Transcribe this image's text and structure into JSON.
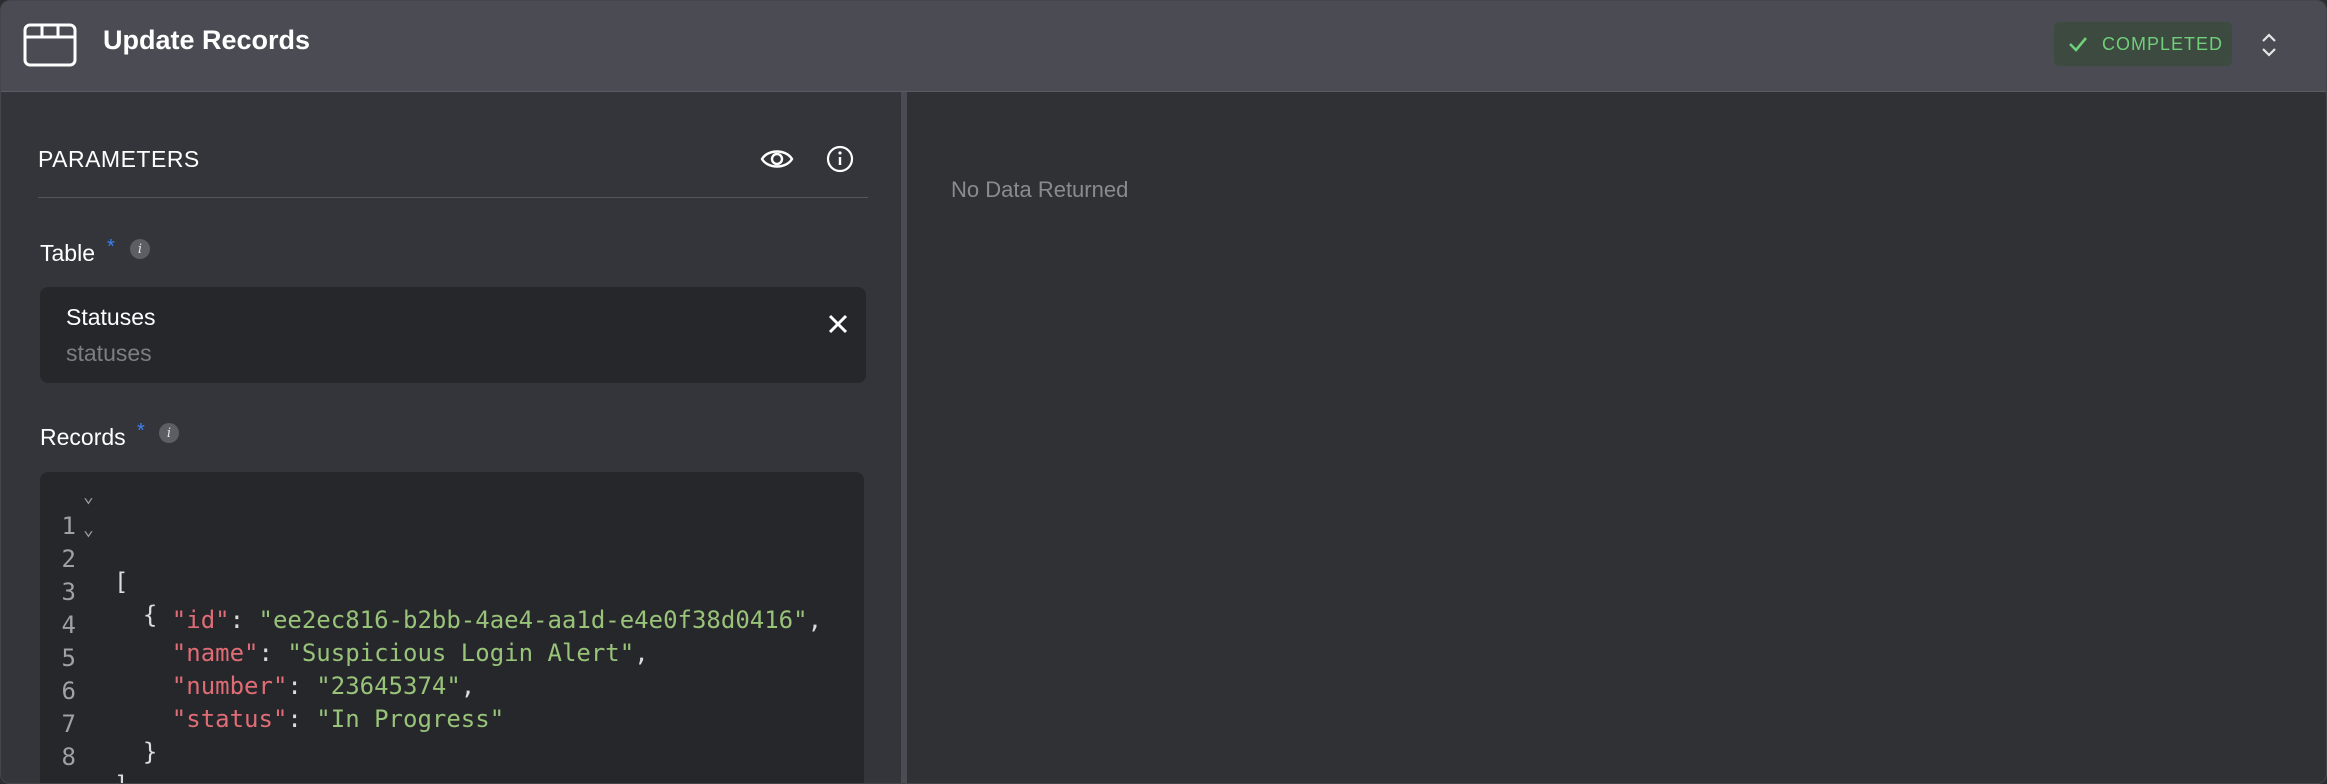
{
  "header": {
    "title": "Update Records",
    "status_label": "COMPLETED",
    "status_color": "#6fcf7a",
    "icons": [
      "app-window-icon",
      "check-icon",
      "expand-collapse-icon"
    ]
  },
  "params": {
    "title": "PARAMETERS",
    "icons": [
      "eye-icon",
      "info-icon"
    ],
    "table": {
      "label": "Table",
      "required_mark": "*",
      "info_mark": "i",
      "selected_name": "Statuses",
      "selected_key": "statuses"
    },
    "records": {
      "label": "Records",
      "required_mark": "*",
      "info_mark": "i",
      "code_lines": [
        {
          "n": "1",
          "fold": "⌄"
        },
        {
          "n": "2",
          "fold": "⌄"
        },
        {
          "n": "3",
          "key": "\"id\"",
          "value": "\"ee2ec816-b2bb-4ae4-aa1d-e4e0f38d0416\"",
          "suffix": ","
        },
        {
          "n": "4",
          "key": "\"name\"",
          "value": "\"Suspicious Login Alert\"",
          "suffix": ","
        },
        {
          "n": "5",
          "key": "\"number\"",
          "value": "\"23645374\"",
          "suffix": ","
        },
        {
          "n": "6",
          "key": "\"status\"",
          "value": "\"In Progress\"",
          "suffix": ""
        },
        {
          "n": "7"
        },
        {
          "n": "8"
        }
      ],
      "brackets": {
        "l1": "[",
        "l2": "  {",
        "l7": "  }",
        "l8": "]"
      }
    }
  },
  "result": {
    "empty_text": "No Data Returned"
  }
}
